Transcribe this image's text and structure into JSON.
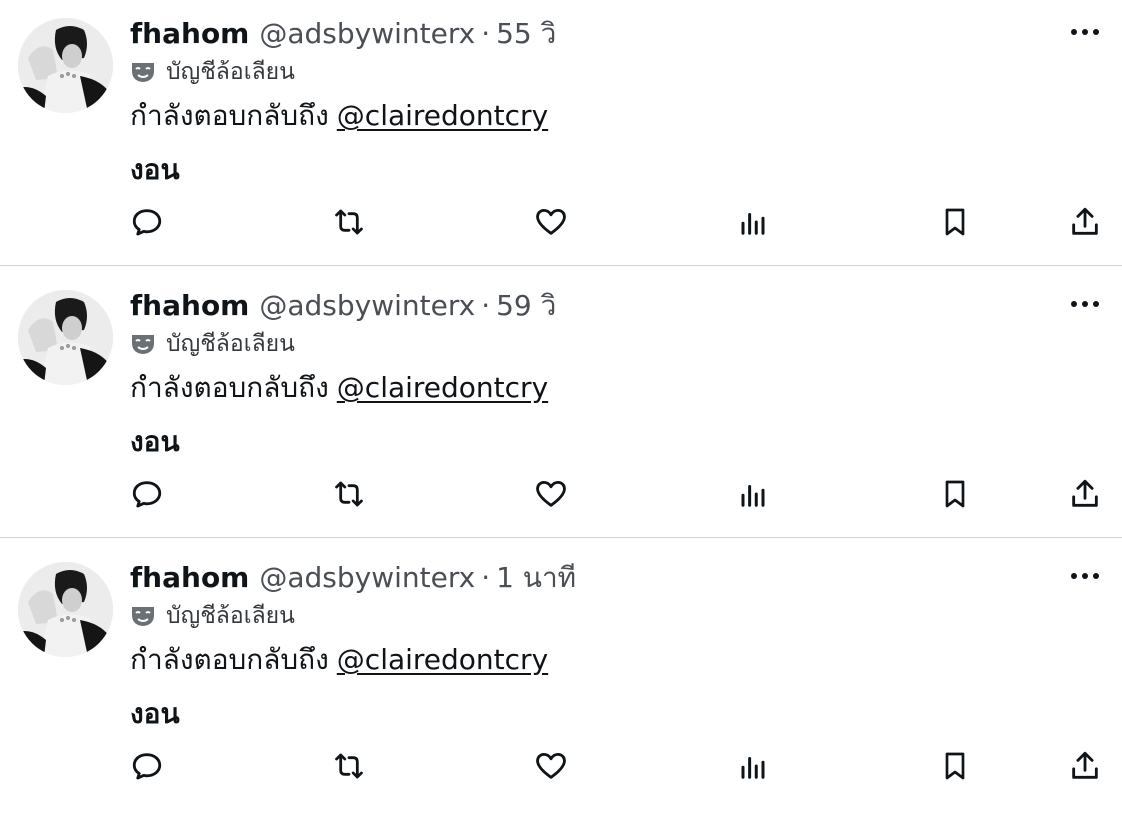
{
  "feed": {
    "tweets": [
      {
        "display_name": "fhahom",
        "handle": "@adsbywinterx",
        "separator": "·",
        "time": "55 วิ",
        "parody_label": "บัญชีล้อเลียน",
        "reply_prefix": "กำลังตอบกลับถึง",
        "reply_mention": "@clairedontcry",
        "text": "งอน"
      },
      {
        "display_name": "fhahom",
        "handle": "@adsbywinterx",
        "separator": "·",
        "time": "59 วิ",
        "parody_label": "บัญชีล้อเลียน",
        "reply_prefix": "กำลังตอบกลับถึง",
        "reply_mention": "@clairedontcry",
        "text": "งอน"
      },
      {
        "display_name": "fhahom",
        "handle": "@adsbywinterx",
        "separator": "·",
        "time": "1 นาที",
        "parody_label": "บัญชีล้อเลียน",
        "reply_prefix": "กำลังตอบกลับถึง",
        "reply_mention": "@clairedontcry",
        "text": "งอน"
      }
    ],
    "icons": {
      "more": "more-icon",
      "parody": "mask-icon",
      "reply": "reply-icon",
      "repost": "repost-icon",
      "like": "heart-icon",
      "views": "views-icon",
      "bookmark": "bookmark-icon",
      "share": "share-icon"
    },
    "colors": {
      "text": "#0f1419",
      "secondary": "#4a4f55",
      "divider": "#cfd3d6",
      "background": "#ffffff"
    }
  }
}
